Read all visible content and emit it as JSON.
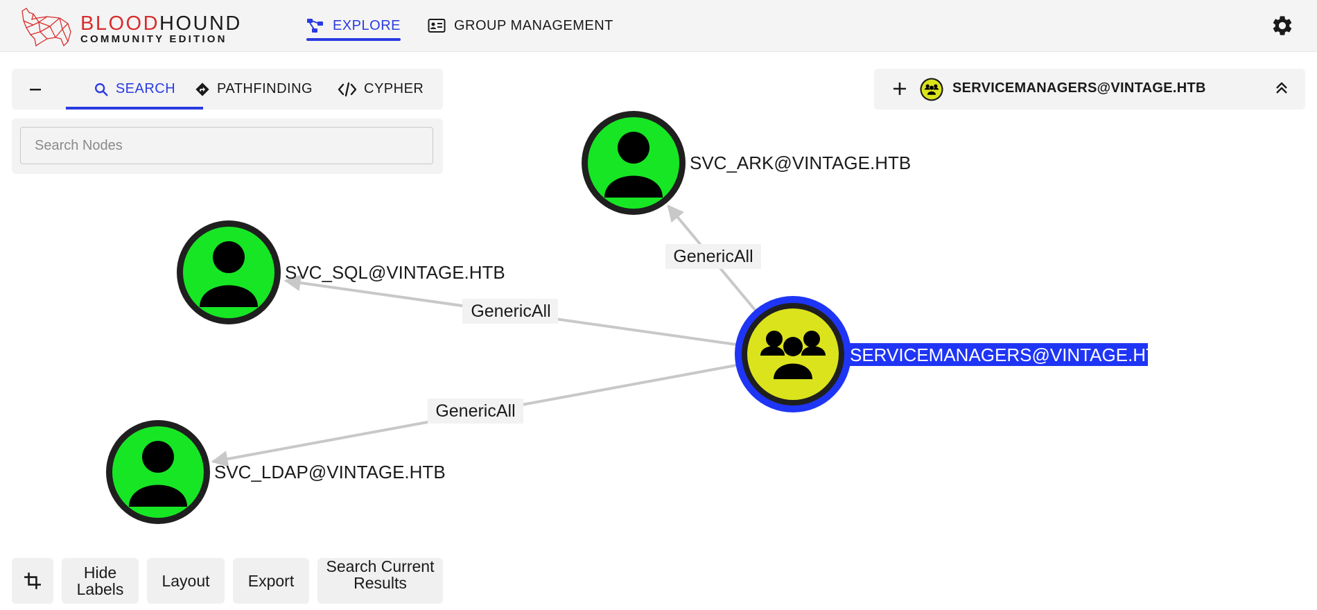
{
  "header": {
    "logo_title_part1": "BLOOD",
    "logo_title_part2": "HOUND",
    "logo_subtitle": "COMMUNITY EDITION",
    "nav": [
      {
        "label": "EXPLORE",
        "icon": "graph-nodes-icon",
        "active": true
      },
      {
        "label": "GROUP MANAGEMENT",
        "icon": "id-card-icon",
        "active": false
      }
    ],
    "settings_icon": "gear-icon"
  },
  "search_panel": {
    "collapse_icon": "minus-icon",
    "tabs": [
      {
        "label": "SEARCH",
        "icon": "search-icon",
        "active": true
      },
      {
        "label": "PATHFINDING",
        "icon": "directions-icon",
        "active": false
      },
      {
        "label": "CYPHER",
        "icon": "code-icon",
        "active": false
      }
    ],
    "search_placeholder": "Search Nodes",
    "search_value": ""
  },
  "selected_node": {
    "name": "SERVICEMANAGERS@VINTAGE.HTB",
    "add_icon": "plus-icon",
    "type_icon": "group-icon",
    "collapse_icon": "chevron-double-up-icon"
  },
  "graph": {
    "nodes": [
      {
        "id": "servicemanagers",
        "label": "SERVICEMANAGERS@VINTAGE.HTB",
        "type": "Group",
        "selected": true,
        "color": "#dbe31c"
      },
      {
        "id": "svc_ark",
        "label": "SVC_ARK@VINTAGE.HTB",
        "type": "User",
        "selected": false,
        "color": "#17e625"
      },
      {
        "id": "svc_sql",
        "label": "SVC_SQL@VINTAGE.HTB",
        "type": "User",
        "selected": false,
        "color": "#17e625"
      },
      {
        "id": "svc_ldap",
        "label": "SVC_LDAP@VINTAGE.HTB",
        "type": "User",
        "selected": false,
        "color": "#17e625"
      }
    ],
    "edges": [
      {
        "from": "servicemanagers",
        "to": "svc_ark",
        "label": "GenericAll"
      },
      {
        "from": "servicemanagers",
        "to": "svc_sql",
        "label": "GenericAll"
      },
      {
        "from": "servicemanagers",
        "to": "svc_ldap",
        "label": "GenericAll"
      }
    ],
    "selection_color": "#1f35f5"
  },
  "bottom_toolbar": {
    "crop_icon": "crop-icon",
    "hide_labels": "Hide Labels",
    "layout": "Layout",
    "export": "Export",
    "search_current_results": "Search Current Results"
  },
  "colors": {
    "accent": "#2a3be0",
    "brand_red": "#d82c2c",
    "user_node": "#17e625",
    "group_node": "#dbe31c"
  }
}
